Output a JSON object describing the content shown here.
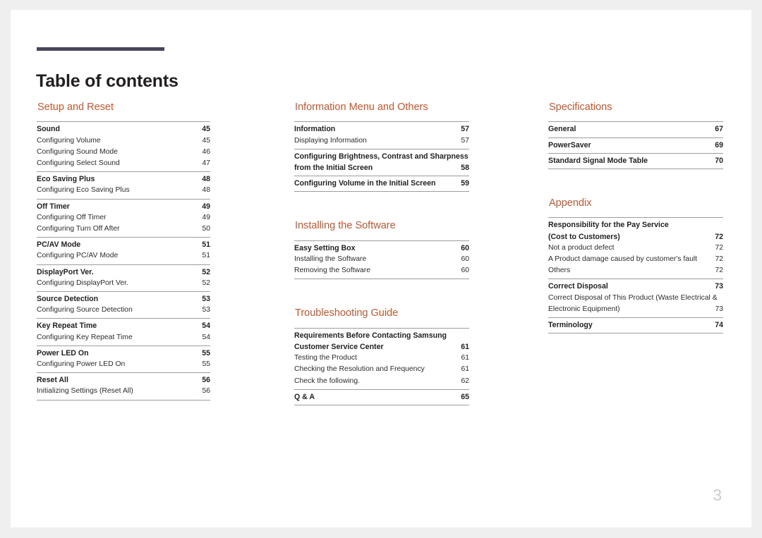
{
  "document": {
    "title": "Table of contents",
    "folio": "3",
    "accent_color": "#c8562f",
    "rule_color": "#474559",
    "folio_color": "#c9ccd4"
  },
  "columns": [
    {
      "name": "column-1",
      "sections": [
        {
          "title": "Setup and Reset",
          "groups": [
            {
              "entries": [
                {
                  "label": "Sound",
                  "page": "45",
                  "level": "major"
                },
                {
                  "label": "Configuring Volume",
                  "page": "45",
                  "level": "minor"
                },
                {
                  "label": "Configuring Sound Mode",
                  "page": "46",
                  "level": "minor"
                },
                {
                  "label": "Configuring Select Sound",
                  "page": "47",
                  "level": "minor"
                }
              ]
            },
            {
              "entries": [
                {
                  "label": "Eco Saving Plus",
                  "page": "48",
                  "level": "major"
                },
                {
                  "label": "Configuring Eco Saving Plus",
                  "page": "48",
                  "level": "minor"
                }
              ]
            },
            {
              "entries": [
                {
                  "label": "Off Timer",
                  "page": "49",
                  "level": "major"
                },
                {
                  "label": "Configuring Off Timer",
                  "page": "49",
                  "level": "minor"
                },
                {
                  "label": "Configuring Turn Off After",
                  "page": "50",
                  "level": "minor"
                }
              ]
            },
            {
              "entries": [
                {
                  "label": "PC/AV Mode",
                  "page": "51",
                  "level": "major"
                },
                {
                  "label": "Configuring PC/AV Mode",
                  "page": "51",
                  "level": "minor"
                }
              ]
            },
            {
              "entries": [
                {
                  "label": "DisplayPort Ver.",
                  "page": "52",
                  "level": "major"
                },
                {
                  "label": "Configuring DisplayPort Ver.",
                  "page": "52",
                  "level": "minor"
                }
              ]
            },
            {
              "entries": [
                {
                  "label": "Source Detection",
                  "page": "53",
                  "level": "major"
                },
                {
                  "label": "Configuring Source Detection",
                  "page": "53",
                  "level": "minor"
                }
              ]
            },
            {
              "entries": [
                {
                  "label": "Key Repeat Time",
                  "page": "54",
                  "level": "major"
                },
                {
                  "label": "Configuring Key Repeat Time",
                  "page": "54",
                  "level": "minor"
                }
              ]
            },
            {
              "entries": [
                {
                  "label": "Power LED On",
                  "page": "55",
                  "level": "major"
                },
                {
                  "label": "Configuring Power LED On",
                  "page": "55",
                  "level": "minor"
                }
              ]
            },
            {
              "entries": [
                {
                  "label": "Reset All",
                  "page": "56",
                  "level": "major"
                },
                {
                  "label": "Initializing Settings (Reset All)",
                  "page": "56",
                  "level": "minor"
                }
              ]
            }
          ]
        }
      ]
    },
    {
      "name": "column-2",
      "sections": [
        {
          "title": "Information Menu and Others",
          "groups": [
            {
              "entries": [
                {
                  "label": "Information",
                  "page": "57",
                  "level": "major"
                },
                {
                  "label": "Displaying Information",
                  "page": "57",
                  "level": "minor"
                }
              ]
            },
            {
              "entries": [
                {
                  "label": "Configuring Brightness, Contrast and Sharpness from the Initial Screen",
                  "line1": "Configuring Brightness, Contrast and Sharpness",
                  "line2": "from the Initial Screen",
                  "page": "58",
                  "level": "major",
                  "wrapped": true
                }
              ]
            },
            {
              "entries": [
                {
                  "label": "Configuring Volume in the Initial Screen",
                  "page": "59",
                  "level": "major"
                }
              ]
            }
          ]
        },
        {
          "title": "Installing the Software",
          "groups": [
            {
              "entries": [
                {
                  "label": "Easy Setting Box",
                  "page": "60",
                  "level": "major"
                },
                {
                  "label": "Installing the Software",
                  "page": "60",
                  "level": "minor"
                },
                {
                  "label": "Removing the Software",
                  "page": "60",
                  "level": "minor"
                }
              ]
            }
          ]
        },
        {
          "title": "Troubleshooting Guide",
          "groups": [
            {
              "entries": [
                {
                  "label": "Requirements Before Contacting Samsung Customer Service Center",
                  "line1": "Requirements Before Contacting Samsung",
                  "line2": "Customer Service Center",
                  "page": "61",
                  "level": "major",
                  "wrapped": true
                },
                {
                  "label": "Testing the Product",
                  "page": "61",
                  "level": "minor"
                },
                {
                  "label": "Checking the Resolution and Frequency",
                  "page": "61",
                  "level": "minor"
                },
                {
                  "label": "Check the following.",
                  "page": "62",
                  "level": "minor"
                }
              ]
            },
            {
              "entries": [
                {
                  "label": "Q & A",
                  "page": "65",
                  "level": "major"
                }
              ]
            }
          ]
        }
      ]
    },
    {
      "name": "column-3",
      "sections": [
        {
          "title": "Specifications",
          "groups": [
            {
              "entries": [
                {
                  "label": "General",
                  "page": "67",
                  "level": "major"
                }
              ]
            },
            {
              "entries": [
                {
                  "label": "PowerSaver",
                  "page": "69",
                  "level": "major"
                }
              ]
            },
            {
              "entries": [
                {
                  "label": "Standard Signal Mode Table",
                  "page": "70",
                  "level": "major"
                }
              ]
            }
          ]
        },
        {
          "title": "Appendix",
          "groups": [
            {
              "entries": [
                {
                  "label": "Responsibility for the Pay Service (Cost to Customers)",
                  "line1": "Responsibility for the Pay Service",
                  "line2": "(Cost to Customers)",
                  "page": "72",
                  "level": "major",
                  "wrapped": true
                },
                {
                  "label": "Not a product defect",
                  "page": "72",
                  "level": "minor"
                },
                {
                  "label": "A Product damage caused by customer's fault",
                  "page": "72",
                  "level": "minor"
                },
                {
                  "label": "Others",
                  "page": "72",
                  "level": "minor"
                }
              ]
            },
            {
              "entries": [
                {
                  "label": "Correct Disposal",
                  "page": "73",
                  "level": "major"
                },
                {
                  "label": "Correct Disposal of This Product (Waste Electrical & Electronic Equipment)",
                  "line1": "Correct Disposal of This Product (Waste Electrical &",
                  "line2": "Electronic Equipment)",
                  "page": "73",
                  "level": "minor",
                  "wrapped": true
                }
              ]
            },
            {
              "entries": [
                {
                  "label": "Terminology",
                  "page": "74",
                  "level": "major"
                }
              ]
            }
          ]
        }
      ]
    }
  ]
}
